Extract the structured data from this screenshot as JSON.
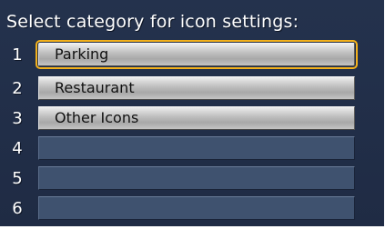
{
  "header": {
    "title": "Select category for icon settings:"
  },
  "menu": {
    "selected_index": 0,
    "items": [
      {
        "number": "1",
        "label": "Parking"
      },
      {
        "number": "2",
        "label": "Restaurant"
      },
      {
        "number": "3",
        "label": "Other Icons"
      },
      {
        "number": "4",
        "label": ""
      },
      {
        "number": "5",
        "label": ""
      },
      {
        "number": "6",
        "label": ""
      }
    ]
  },
  "colors": {
    "background": "#24324d",
    "selection_border": "#f3b11c",
    "empty_item": "#3f526f",
    "filled_item": "#c4c4c4"
  }
}
